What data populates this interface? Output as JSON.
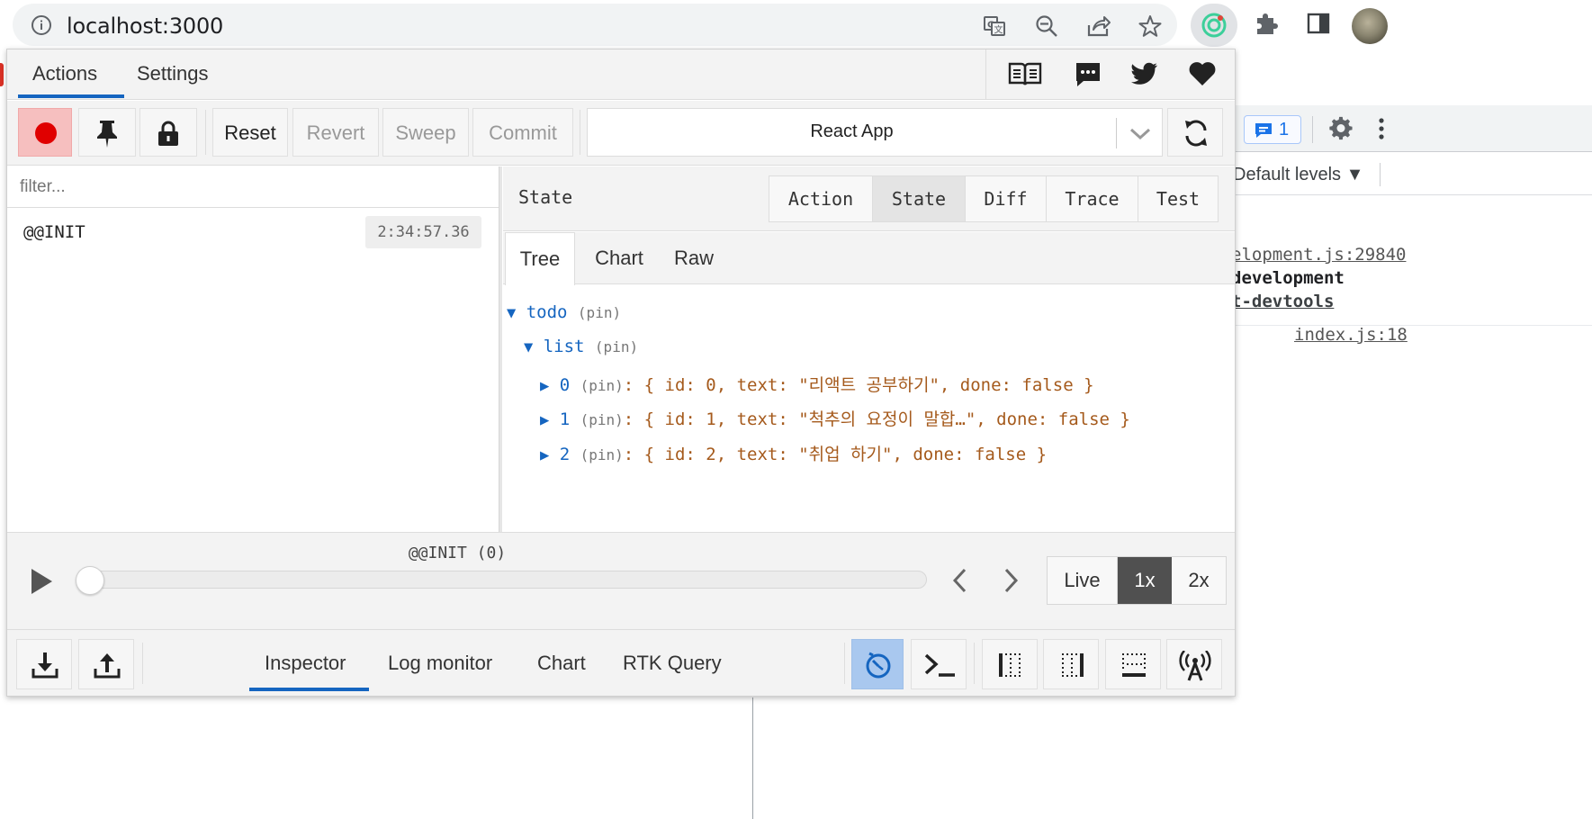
{
  "browser": {
    "url": "localhost:3000",
    "icons": [
      "info-icon",
      "translate-icon",
      "zoom-out-icon",
      "share-icon",
      "bookmark-star-icon",
      "redux-extension-icon",
      "extensions-puzzle-icon",
      "side-panel-icon",
      "profile-avatar"
    ]
  },
  "devtools_bg": {
    "message_count": "1",
    "default_levels": "Default levels ▼",
    "lines": [
      "elopment.js:29840",
      "development",
      "t-devtools",
      "index.js:18"
    ]
  },
  "redux_devtools": {
    "top_tabs": [
      {
        "label": "Actions",
        "active": true
      },
      {
        "label": "Settings",
        "active": false
      }
    ],
    "top_icons": [
      "docs-book-icon",
      "feedback-chat-icon",
      "twitter-icon",
      "heart-icon"
    ],
    "toolbar": {
      "reset": "Reset",
      "revert": "Revert",
      "sweep": "Sweep",
      "commit": "Commit",
      "instance": "React App"
    },
    "filter_placeholder": "filter...",
    "actions": [
      {
        "name": "@@INIT",
        "time": "2:34:57.36"
      }
    ],
    "right_pane": {
      "title": "State",
      "tabs": [
        {
          "label": "Action",
          "active": false
        },
        {
          "label": "State",
          "active": true
        },
        {
          "label": "Diff",
          "active": false
        },
        {
          "label": "Trace",
          "active": false
        },
        {
          "label": "Test",
          "active": false
        }
      ],
      "view_tabs": [
        {
          "label": "Tree",
          "active": true
        },
        {
          "label": "Chart",
          "active": false
        },
        {
          "label": "Raw",
          "active": false
        }
      ],
      "tree": {
        "root_key": "todo",
        "pin": "(pin)",
        "list_key": "list",
        "items": [
          {
            "key": "0",
            "preview": ": { id: 0, text: \"리액트 공부하기\", done: false }"
          },
          {
            "key": "1",
            "preview": ": { id: 1, text: \"척추의 요정이 말합…\", done: false }"
          },
          {
            "key": "2",
            "preview": ": { id: 2, text: \"취업 하기\", done: false }"
          }
        ]
      }
    },
    "slider": {
      "label": "@@INIT (0)",
      "position": 0,
      "speeds": [
        {
          "label": "Live",
          "active": false
        },
        {
          "label": "1x",
          "active": true
        },
        {
          "label": "2x",
          "active": false
        }
      ]
    },
    "monitors": [
      {
        "label": "Inspector",
        "active": true
      },
      {
        "label": "Log monitor",
        "active": false
      },
      {
        "label": "Chart",
        "active": false
      },
      {
        "label": "RTK Query",
        "active": false
      }
    ],
    "accent_color": "#1565c0",
    "record_color": "#e00000"
  }
}
